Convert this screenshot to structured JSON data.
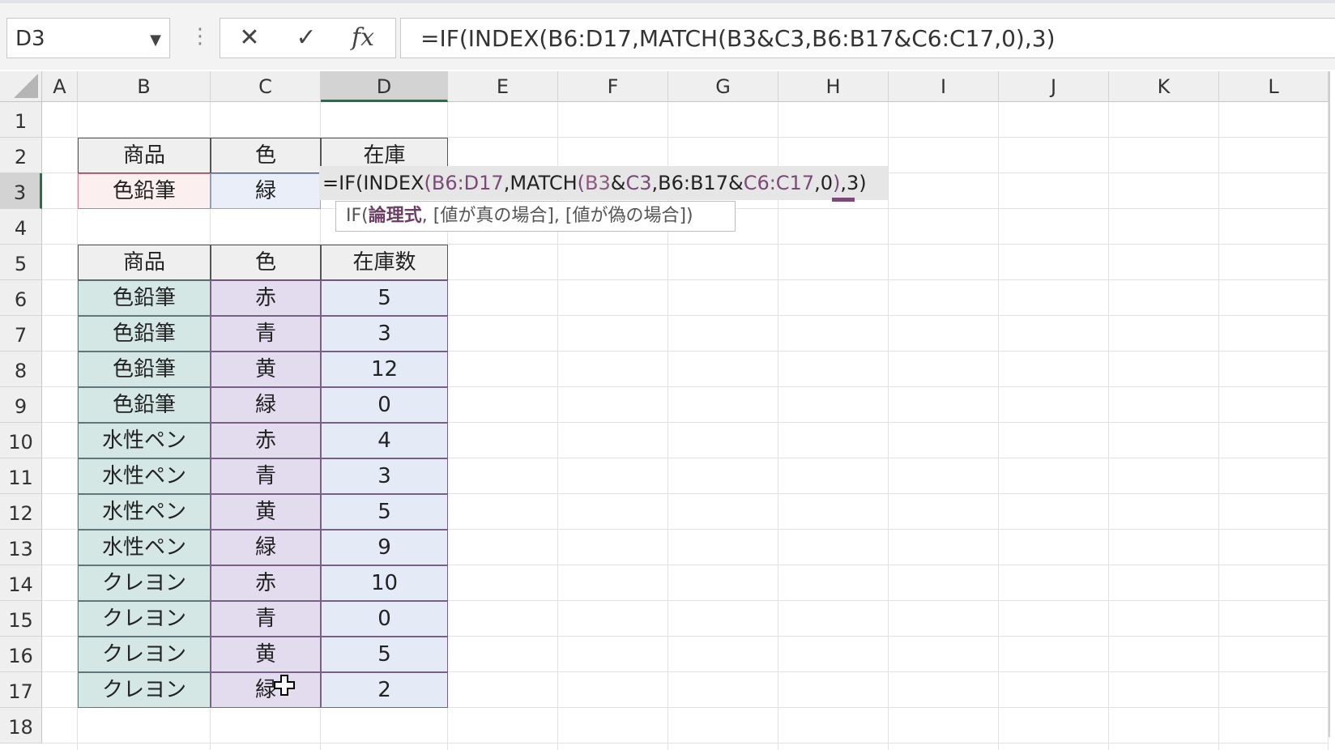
{
  "name_box": {
    "value": "D3"
  },
  "formula_bar": {
    "cancel_glyph": "✕",
    "enter_glyph": "✓",
    "fx_label": "fx",
    "value": "=IF(INDEX(B6:D17,MATCH(B3&C3,B6:B17&C6:C17,0),3)"
  },
  "columns": [
    "A",
    "B",
    "C",
    "D",
    "E",
    "F",
    "G",
    "H",
    "I",
    "J",
    "K",
    "L"
  ],
  "selected_column": "D",
  "rows": [
    "1",
    "2",
    "3",
    "4",
    "5",
    "6",
    "7",
    "8",
    "9",
    "10",
    "11",
    "12",
    "13",
    "14",
    "15",
    "16",
    "17",
    "18"
  ],
  "selected_row": "3",
  "lookup": {
    "headers": [
      "商品",
      "色",
      "在庫"
    ],
    "product": "色鉛筆",
    "color": "緑"
  },
  "edit": {
    "parts": [
      "=IF(INDEX",
      "(",
      "B6:D17",
      ",MATCH",
      "(",
      "B3",
      "&",
      "C3",
      ",B6:B17&",
      "C6:C17",
      ",0",
      ")",
      ",3",
      ")"
    ]
  },
  "tooltip": {
    "prefix": "IF(",
    "current_arg": "論理式",
    "rest": ", [値が真の場合], [値が偽の場合])"
  },
  "table": {
    "headers": [
      "商品",
      "色",
      "在庫数"
    ],
    "rows": [
      [
        "色鉛筆",
        "赤",
        "5"
      ],
      [
        "色鉛筆",
        "青",
        "3"
      ],
      [
        "色鉛筆",
        "黄",
        "12"
      ],
      [
        "色鉛筆",
        "緑",
        "0"
      ],
      [
        "水性ペン",
        "赤",
        "4"
      ],
      [
        "水性ペン",
        "青",
        "3"
      ],
      [
        "水性ペン",
        "黄",
        "5"
      ],
      [
        "水性ペン",
        "緑",
        "9"
      ],
      [
        "クレヨン",
        "赤",
        "10"
      ],
      [
        "クレヨン",
        "青",
        "0"
      ],
      [
        "クレヨン",
        "黄",
        "5"
      ],
      [
        "クレヨン",
        "緑",
        "2"
      ]
    ]
  },
  "colors": {
    "selection_green": "#217346",
    "ref_purple": "#7b4a76",
    "product_fill": "#d4e7e4",
    "color_fill": "#e3dcef",
    "stock_fill": "#e4ebf6"
  }
}
